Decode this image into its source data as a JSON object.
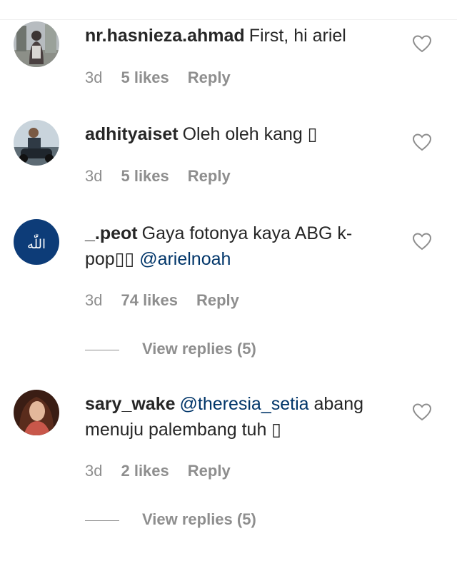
{
  "comments": [
    {
      "username": "nr.hasnieza.ahmad",
      "text": "First, hi ariel",
      "time": "3d",
      "likes": "5 likes",
      "reply": "Reply"
    },
    {
      "username": "adhityaiset",
      "text": "Oleh oleh kang ▯",
      "time": "3d",
      "likes": "5 likes",
      "reply": "Reply"
    },
    {
      "username": "_.peot",
      "text": "Gaya fotonya kaya ABG k-pop▯▯",
      "mention": "@arielnoah",
      "time": "3d",
      "likes": "74 likes",
      "reply": "Reply",
      "view_replies": "View replies (5)"
    },
    {
      "username": "sary_wake",
      "mention": "@theresia_setia",
      "text": "abang menuju palembang tuh ▯",
      "time": "3d",
      "likes": "2 likes",
      "reply": "Reply",
      "view_replies": "View replies (5)"
    }
  ],
  "icons": {
    "like": "heart-outline-icon"
  },
  "colors": {
    "text": "#262626",
    "secondary": "#8e8e8e",
    "mention": "#003569",
    "avatar3_bg": "#0d3c78"
  }
}
